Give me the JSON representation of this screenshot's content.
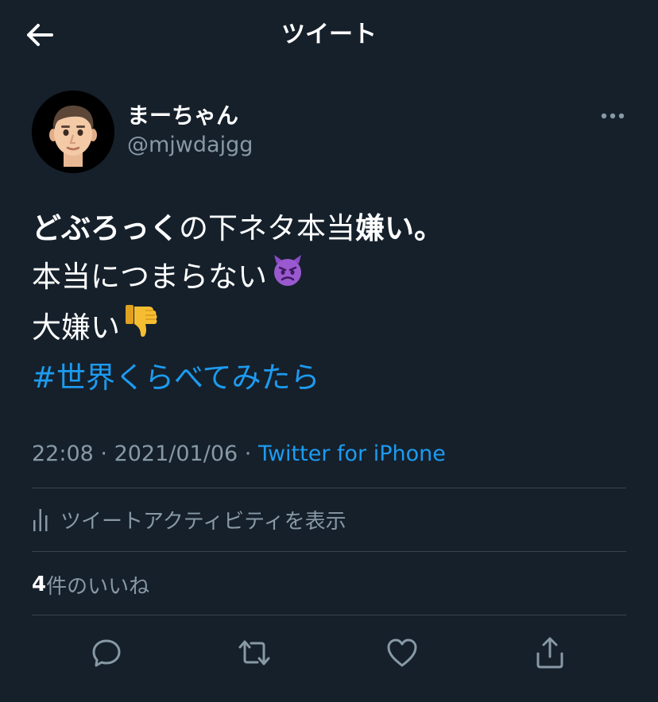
{
  "header": {
    "title": "ツイート"
  },
  "tweet": {
    "display_name": "まーちゃん",
    "handle": "@mjwdajgg",
    "line1": {
      "part1_bold": "どぶろっく",
      "part2": "の下ネタ本当",
      "part3_bold": "嫌い。"
    },
    "line2": "本当につまらない",
    "line3": "大嫌い",
    "hashtag": "#世界くらべてみたら",
    "line2_emoji": "devil-face",
    "line3_emoji": "thumbs-down"
  },
  "meta": {
    "time": "22:08",
    "separator1": " · ",
    "date": "2021/01/06",
    "separator2": " · ",
    "source": "Twitter for iPhone"
  },
  "activity": {
    "label": "ツイートアクティビティを表示"
  },
  "likes": {
    "count": "4",
    "label": "件のいいね"
  },
  "actions": [
    "reply-icon",
    "retweet-icon",
    "like-icon",
    "share-icon"
  ],
  "colors": {
    "background": "#15202b",
    "divider": "#38444d",
    "secondary_text": "#8899a6",
    "link": "#1d9bf0"
  }
}
